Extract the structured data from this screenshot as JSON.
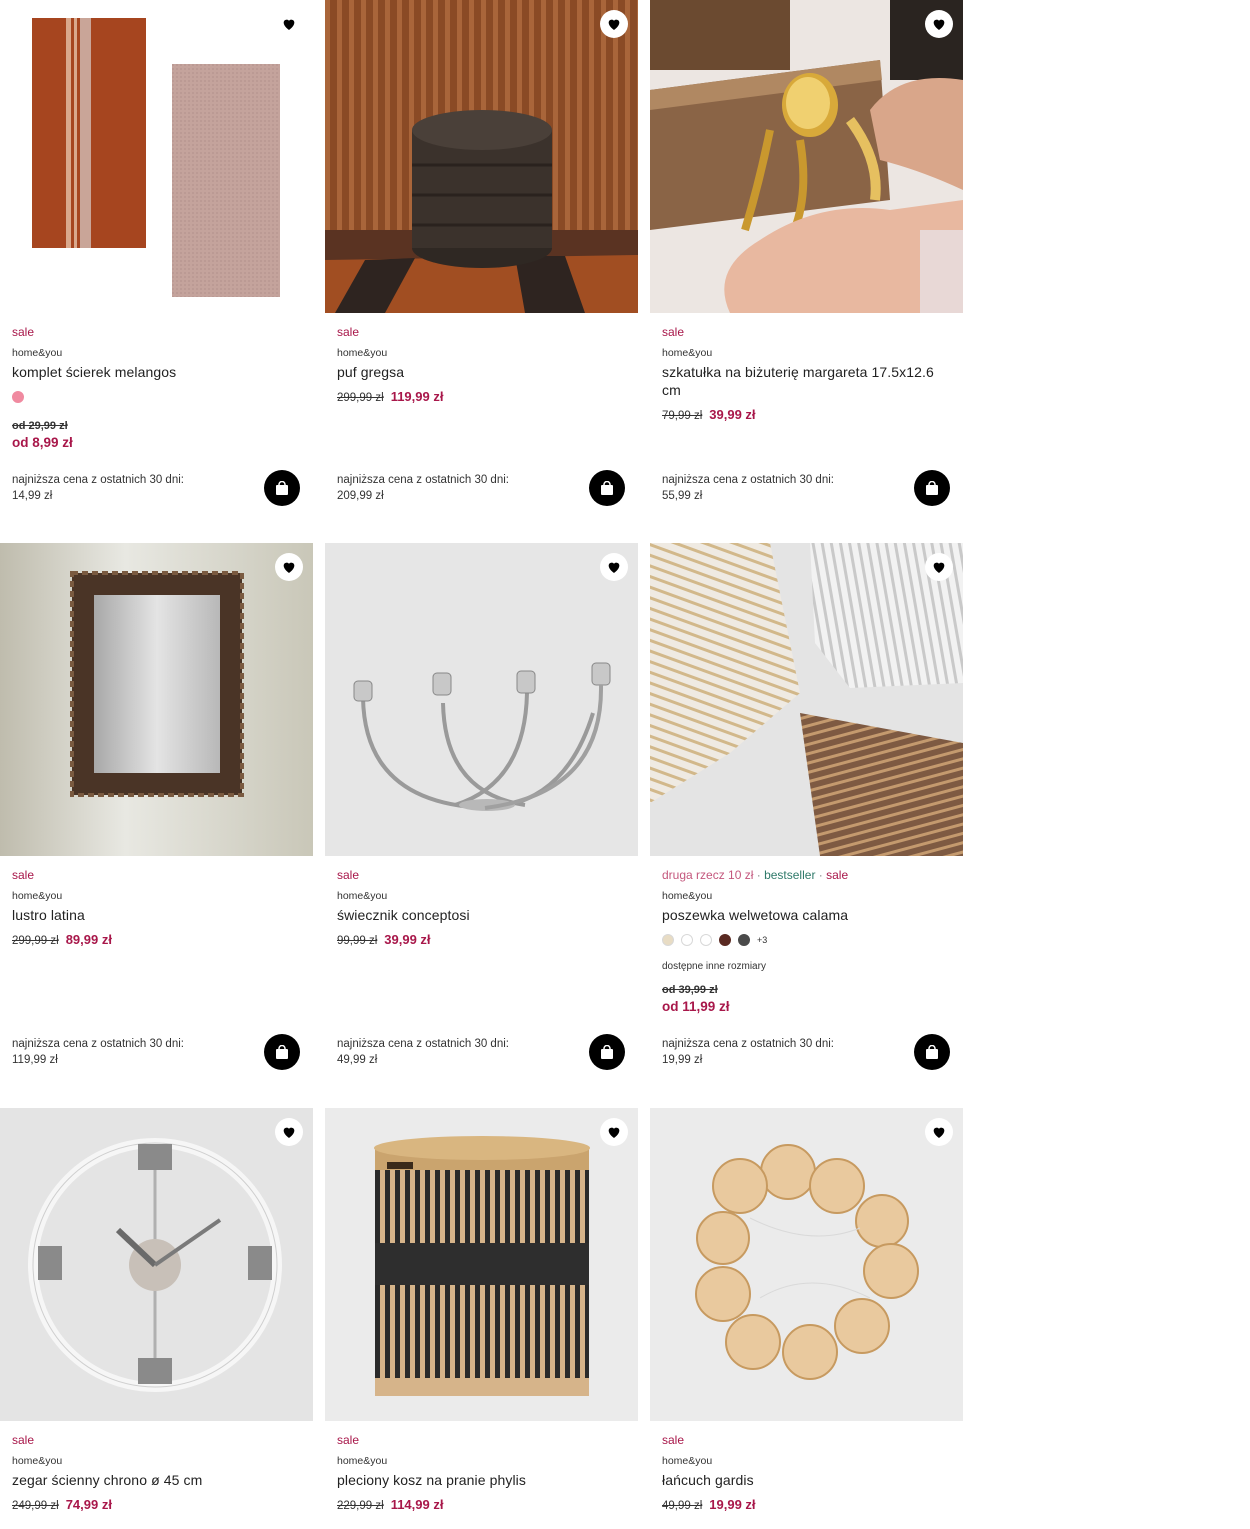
{
  "labels": {
    "lowest_price": "najniższa cena z ostatnich 30 dni:"
  },
  "colors": {
    "sale": "#a8174a",
    "bestseller": "#2f7a6a",
    "cart_bg": "#000000"
  },
  "products": [
    {
      "tags": [
        "sale"
      ],
      "brand": "home&you",
      "name": "komplet ścierek melangos",
      "swatches": [
        "#f08aa0"
      ],
      "price_from": true,
      "old_price": "od 29,99 zł",
      "new_price": "od 8,99 zł",
      "lowest_price": "14,99 zł",
      "icon": "heart-icon"
    },
    {
      "tags": [
        "sale"
      ],
      "brand": "home&you",
      "name": "puf gregsa",
      "old_price": "299,99 zł",
      "new_price": "119,99 zł",
      "lowest_price": "209,99 zł"
    },
    {
      "tags": [
        "sale"
      ],
      "brand": "home&you",
      "name": "szkatułka na biżuterię margareta 17.5x12.6 cm",
      "old_price": "79,99 zł",
      "new_price": "39,99 zł",
      "lowest_price": "55,99 zł"
    },
    {
      "tags": [
        "sale"
      ],
      "brand": "home&you",
      "name": "lustro latina",
      "old_price": "299,99 zł",
      "new_price": "89,99 zł",
      "lowest_price": "119,99 zł"
    },
    {
      "tags": [
        "sale"
      ],
      "brand": "home&you",
      "name": "świecznik conceptosi",
      "old_price": "99,99 zł",
      "new_price": "39,99 zł",
      "lowest_price": "49,99 zł"
    },
    {
      "tags": [
        "druga rzecz 10 zł",
        "bestseller",
        "sale"
      ],
      "brand": "home&you",
      "name": "poszewka welwetowa calama",
      "swatches": [
        "#e8dcc4",
        "#ffffff",
        "#ffffff",
        "#5a2a22",
        "#4a4a4a"
      ],
      "swatches_more": "+3",
      "sizes_note": "dostępne inne rozmiary",
      "price_from": true,
      "old_price": "od 39,99 zł",
      "new_price": "od 11,99 zł",
      "lowest_price": "19,99 zł"
    },
    {
      "tags": [
        "sale"
      ],
      "brand": "home&you",
      "name": "zegar ścienny chrono ø 45 cm",
      "old_price": "249,99 zł",
      "new_price": "74,99 zł"
    },
    {
      "tags": [
        "sale"
      ],
      "brand": "home&you",
      "name": "pleciony kosz na pranie phylis",
      "old_price": "229,99 zł",
      "new_price": "114,99 zł"
    },
    {
      "tags": [
        "sale"
      ],
      "brand": "home&you",
      "name": "łańcuch gardis",
      "old_price": "49,99 zł",
      "new_price": "19,99 zł"
    }
  ]
}
